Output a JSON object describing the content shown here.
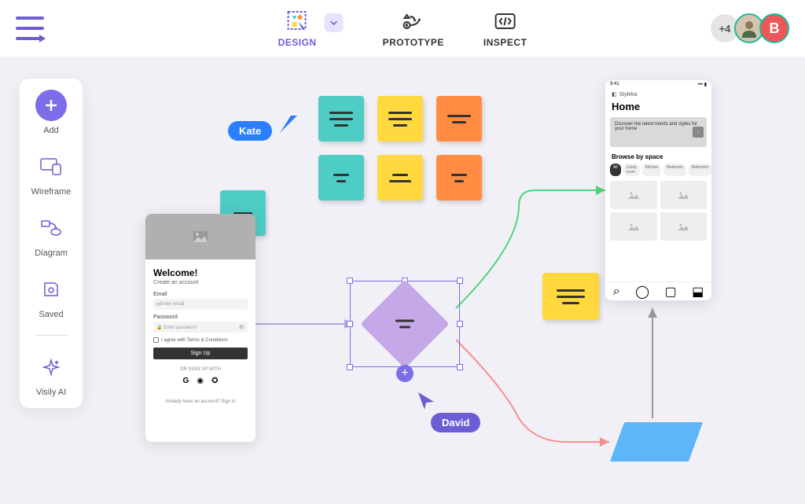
{
  "header": {
    "tabs": {
      "design": "DESIGN",
      "prototype": "PROTOTYPE",
      "inspect": "INSPECT"
    },
    "more_count": "+4",
    "badge_letter": "B"
  },
  "sidebar": {
    "add": "Add",
    "wireframe": "Wireframe",
    "diagram": "Diagram",
    "saved": "Saved",
    "ai": "Visily AI"
  },
  "cursors": {
    "kate": "Kate",
    "david": "David"
  },
  "welcome_screen": {
    "title": "Welcome!",
    "subtitle": "Create an account",
    "email_label": "Email",
    "email_placeholder": "Enter email",
    "password_label": "Password",
    "password_placeholder": "Enter password",
    "terms": "I agree with Terms & Conditions",
    "signup_btn": "Sign Up",
    "or_text": "OR SIGN UP WITH",
    "footer": "Already have an account? Sign in"
  },
  "home_screen": {
    "time": "9:41",
    "brand": "Styleka",
    "title": "Home",
    "banner": "Discover the latest trends and styles for your home",
    "section": "Browse by space",
    "chips": [
      "All",
      "Living room",
      "Kitchen",
      "Bedroom",
      "Bathroom"
    ]
  }
}
